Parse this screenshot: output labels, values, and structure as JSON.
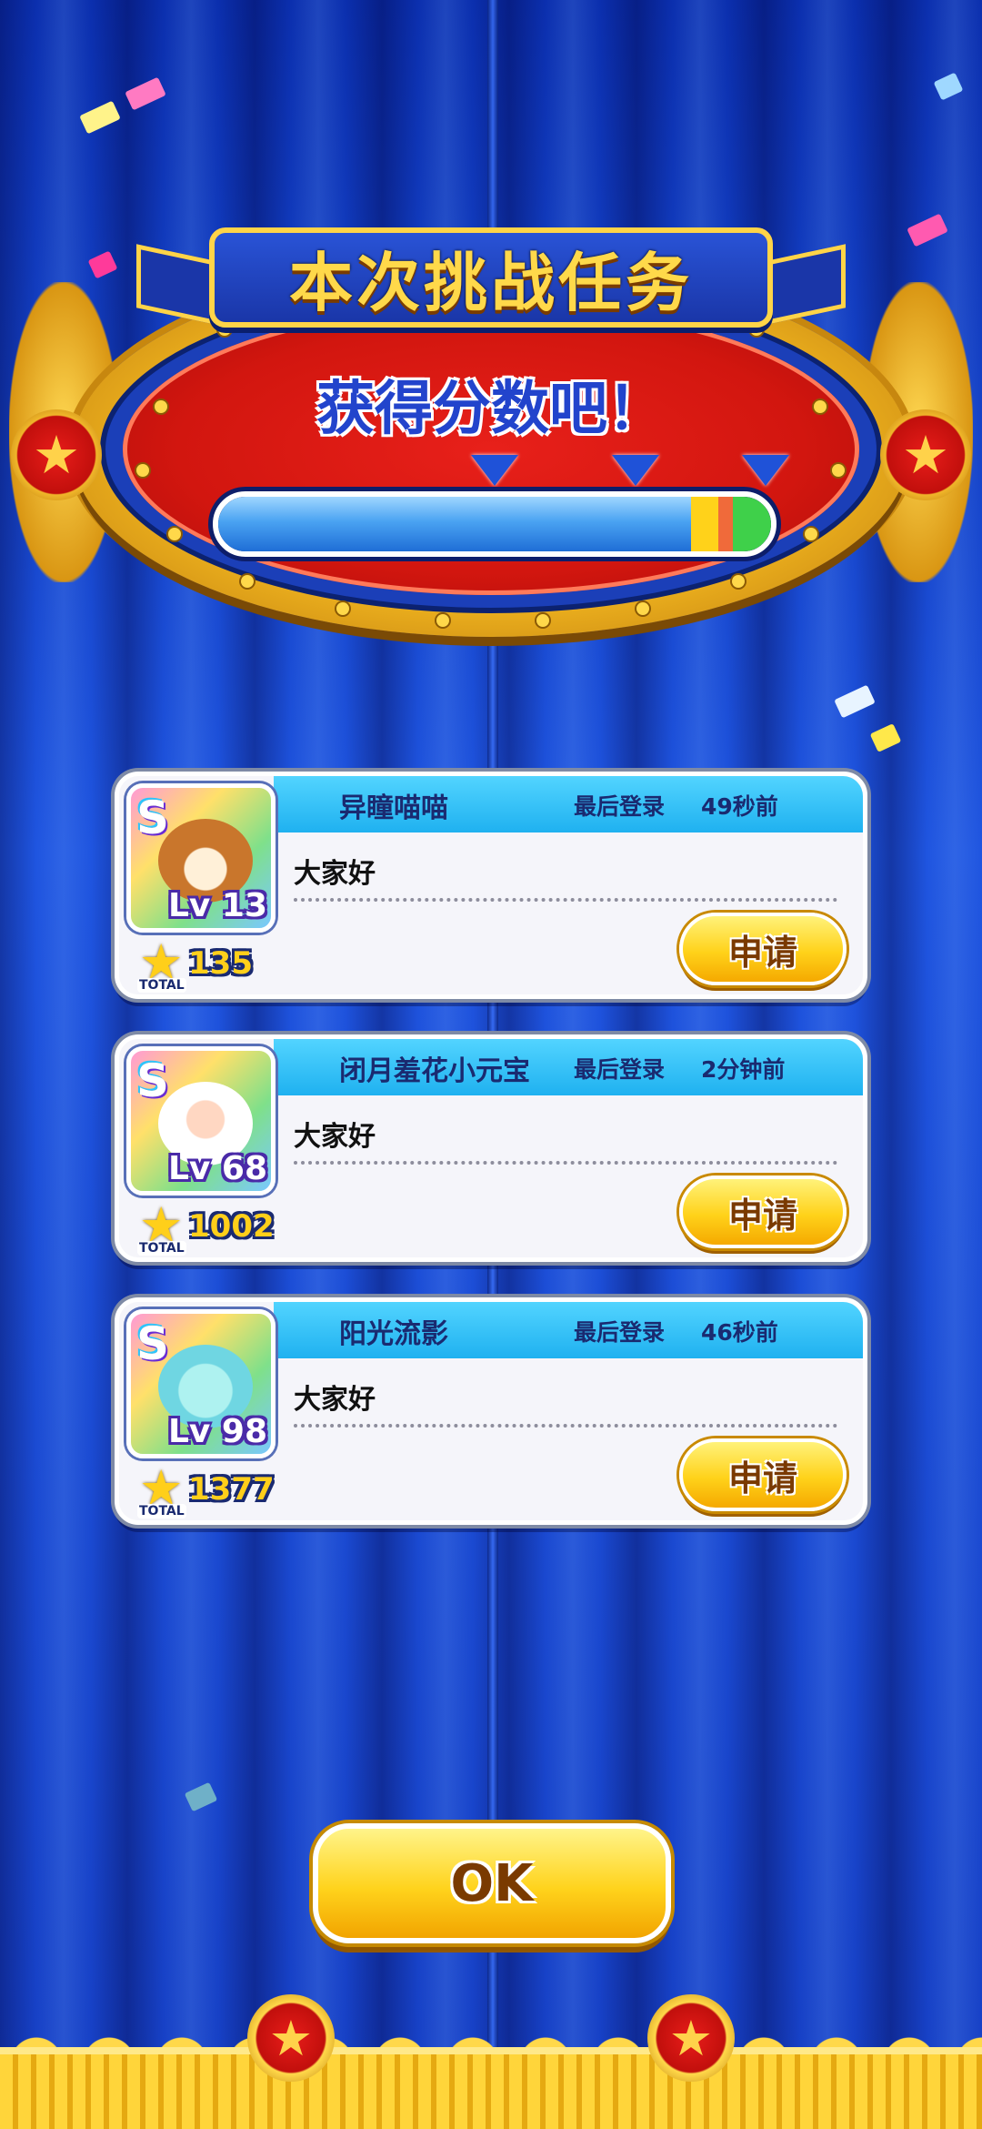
{
  "banner": {
    "title": "本次挑战任务"
  },
  "mission": {
    "text": "获得分数吧！",
    "progress": 0.94,
    "milestones": [
      0.5,
      0.75,
      0.98
    ]
  },
  "friends": [
    {
      "name": "异瞳喵喵",
      "last_login_label": "最后登录",
      "last_login_time": "49秒前",
      "message": "大家好",
      "rank": "S",
      "level_label": "Lv 13",
      "total_label": "TOTAL",
      "total": "135",
      "apply_label": "申请",
      "avatar_icon": "chipmunk-tsum-icon"
    },
    {
      "name": "闭月羞花小元宝",
      "last_login_label": "最后登录",
      "last_login_time": "2分钟前",
      "message": "大家好",
      "rank": "S",
      "level_label": "Lv 68",
      "total_label": "TOTAL",
      "total": "1002",
      "apply_label": "申请",
      "avatar_icon": "bearded-king-tsum-icon"
    },
    {
      "name": "阳光流影",
      "last_login_label": "最后登录",
      "last_login_time": "46秒前",
      "message": "大家好",
      "rank": "S",
      "level_label": "Lv 98",
      "total_label": "TOTAL",
      "total": "1377",
      "apply_label": "申请",
      "avatar_icon": "ghost-bride-tsum-icon"
    }
  ],
  "ok_button": {
    "label": "OK"
  },
  "colors": {
    "curtain": "#1f55e0",
    "frame_red": "#d2160f",
    "gold": "#ffd448",
    "card_header": "#1fb1f0"
  }
}
